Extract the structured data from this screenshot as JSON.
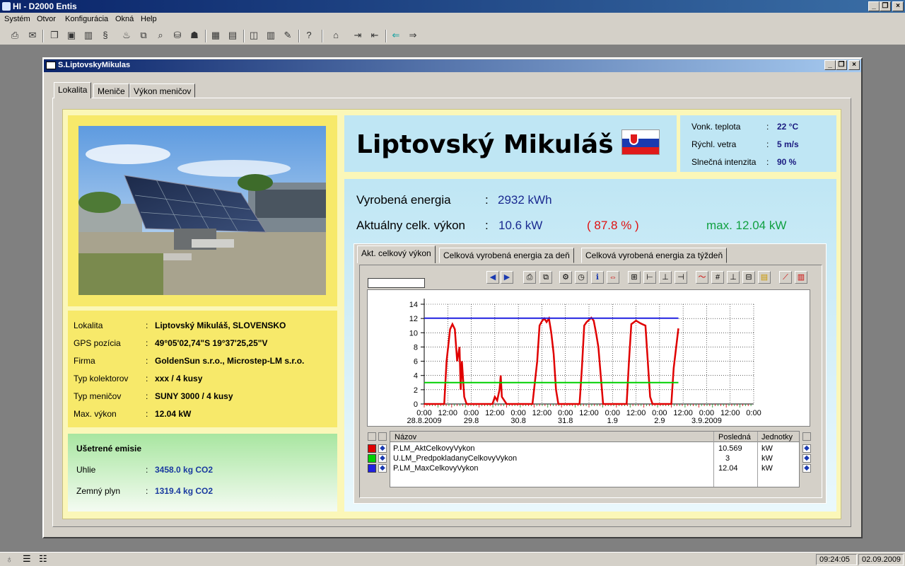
{
  "app": {
    "title": "HI - D2000 Entis"
  },
  "menu": [
    "Systém",
    "Otvor",
    "Konfigurácia",
    "Okná",
    "Help"
  ],
  "window": {
    "title": "S.LiptovskyMikulas"
  },
  "tabs": [
    "Lokalita",
    "Meniče",
    "Výkon meničov"
  ],
  "city": {
    "name": "Liptovský Mikuláš"
  },
  "weather": [
    {
      "label": "Vonk. teplota",
      "value": "22 °C"
    },
    {
      "label": "Rýchl. vetra",
      "value": "5 m/s"
    },
    {
      "label": "Slnečná intenzita",
      "value": "90 %"
    }
  ],
  "info": [
    {
      "label": "Lokalita",
      "value": "Liptovský Mikuláš, SLOVENSKO"
    },
    {
      "label": "GPS pozícia",
      "value": "49°05'02,74\"S 19°37'25,25\"V"
    },
    {
      "label": "Firma",
      "value": "GoldenSun s.r.o., Microstep-LM s.r.o."
    },
    {
      "label": "Typ kolektorov",
      "value": "xxx / 4 kusy"
    },
    {
      "label": "Typ meničov",
      "value": "SUNY 3000 / 4 kusy"
    },
    {
      "label": "Max. výkon",
      "value": "12.04 kW"
    }
  ],
  "emissions": {
    "title": "Ušetrené emisie",
    "rows": [
      {
        "label": "Uhlie",
        "value": "3458.0  kg CO2"
      },
      {
        "label": "Zemný plyn",
        "value": "1319.4  kg CO2"
      }
    ]
  },
  "energy": {
    "produced_label": "Vyrobená energia",
    "produced_value": "2932 kWh",
    "power_label": "Aktuálny celk. výkon",
    "power_value": "10.6 kW",
    "power_pct": "( 87.8 % )",
    "power_max": "max. 12.04 kW",
    "colon": ":"
  },
  "chart_tabs": [
    "Akt. celkový výkon",
    "Celková vyrobená energia za deň",
    "Celková vyrobená energia za týždeň"
  ],
  "legend": {
    "headers": [
      "Názov",
      "Posledná",
      "Jednotky"
    ],
    "rows": [
      {
        "name": "P.LM_AktCelkovyVykon",
        "last": "10.569",
        "unit": "kW",
        "color": "#e00000"
      },
      {
        "name": "U.LM_PredpokladanyCelkovyVykon",
        "last": "3",
        "unit": "kW",
        "color": "#00d000"
      },
      {
        "name": "P.LM_MaxCelkovyVykon",
        "last": "12.04",
        "unit": "kW",
        "color": "#2020e0"
      }
    ]
  },
  "status": {
    "time": "09:24:05",
    "date": "02.09.2009"
  },
  "chart_data": {
    "type": "line",
    "ylim": [
      0,
      14
    ],
    "yticks": [
      0,
      2,
      4,
      6,
      8,
      10,
      12,
      14
    ],
    "xlim": [
      0,
      14
    ],
    "x_time_labels": [
      "0:00",
      "12:00",
      "0:00",
      "12:00",
      "0:00",
      "12:00",
      "0:00",
      "12:00",
      "0:00",
      "12:00",
      "0:00",
      "12:00",
      "0:00",
      "12:00",
      "0:00"
    ],
    "x_date_labels": [
      {
        "x": 0,
        "text": "28.8.2009"
      },
      {
        "x": 2,
        "text": "29.8"
      },
      {
        "x": 4,
        "text": "30.8"
      },
      {
        "x": 6,
        "text": "31.8"
      },
      {
        "x": 8,
        "text": "1.9"
      },
      {
        "x": 10,
        "text": "2.9"
      },
      {
        "x": 12,
        "text": "3.9.2009"
      }
    ],
    "series": [
      {
        "name": "P.LM_AktCelkovyVykon",
        "color": "#e00000",
        "x": [
          0,
          0.85,
          0.95,
          1.1,
          1.2,
          1.3,
          1.4,
          1.5,
          1.55,
          1.6,
          1.7,
          1.8,
          1.9,
          2.1,
          2.9,
          3.0,
          3.1,
          3.2,
          3.25,
          3.3,
          3.4,
          3.5,
          4.6,
          4.8,
          4.9,
          5.0,
          5.1,
          5.2,
          5.3,
          5.4,
          5.5,
          5.6,
          5.7,
          6.6,
          6.7,
          6.8,
          6.9,
          7.0,
          7.1,
          7.2,
          7.3,
          7.4,
          7.6,
          8.6,
          8.7,
          8.8,
          9.0,
          9.2,
          9.4,
          9.5,
          9.6,
          9.7,
          10.5,
          10.6,
          10.8
        ],
        "y": [
          0,
          0,
          6,
          10.5,
          11.2,
          10.5,
          6,
          8,
          2,
          6,
          1,
          0,
          0,
          0,
          0,
          1,
          0.5,
          2,
          4,
          1,
          0.5,
          0,
          0,
          6,
          11,
          11.6,
          12,
          11.5,
          12,
          10,
          7,
          2,
          0,
          0,
          5,
          11,
          11.5,
          11.8,
          12.1,
          11.7,
          10,
          8,
          0,
          0,
          6,
          11.2,
          11.7,
          11.3,
          11,
          6,
          1,
          0,
          0,
          5,
          10.6
        ]
      },
      {
        "name": "U.LM_PredpokladanyCelkovyVykon",
        "color": "#00d000",
        "x": [
          0,
          10.8
        ],
        "y": [
          3,
          3
        ]
      },
      {
        "name": "P.LM_MaxCelkovyVykon",
        "color": "#2020e0",
        "x": [
          0,
          10.8
        ],
        "y": [
          12.04,
          12.04
        ]
      }
    ]
  }
}
